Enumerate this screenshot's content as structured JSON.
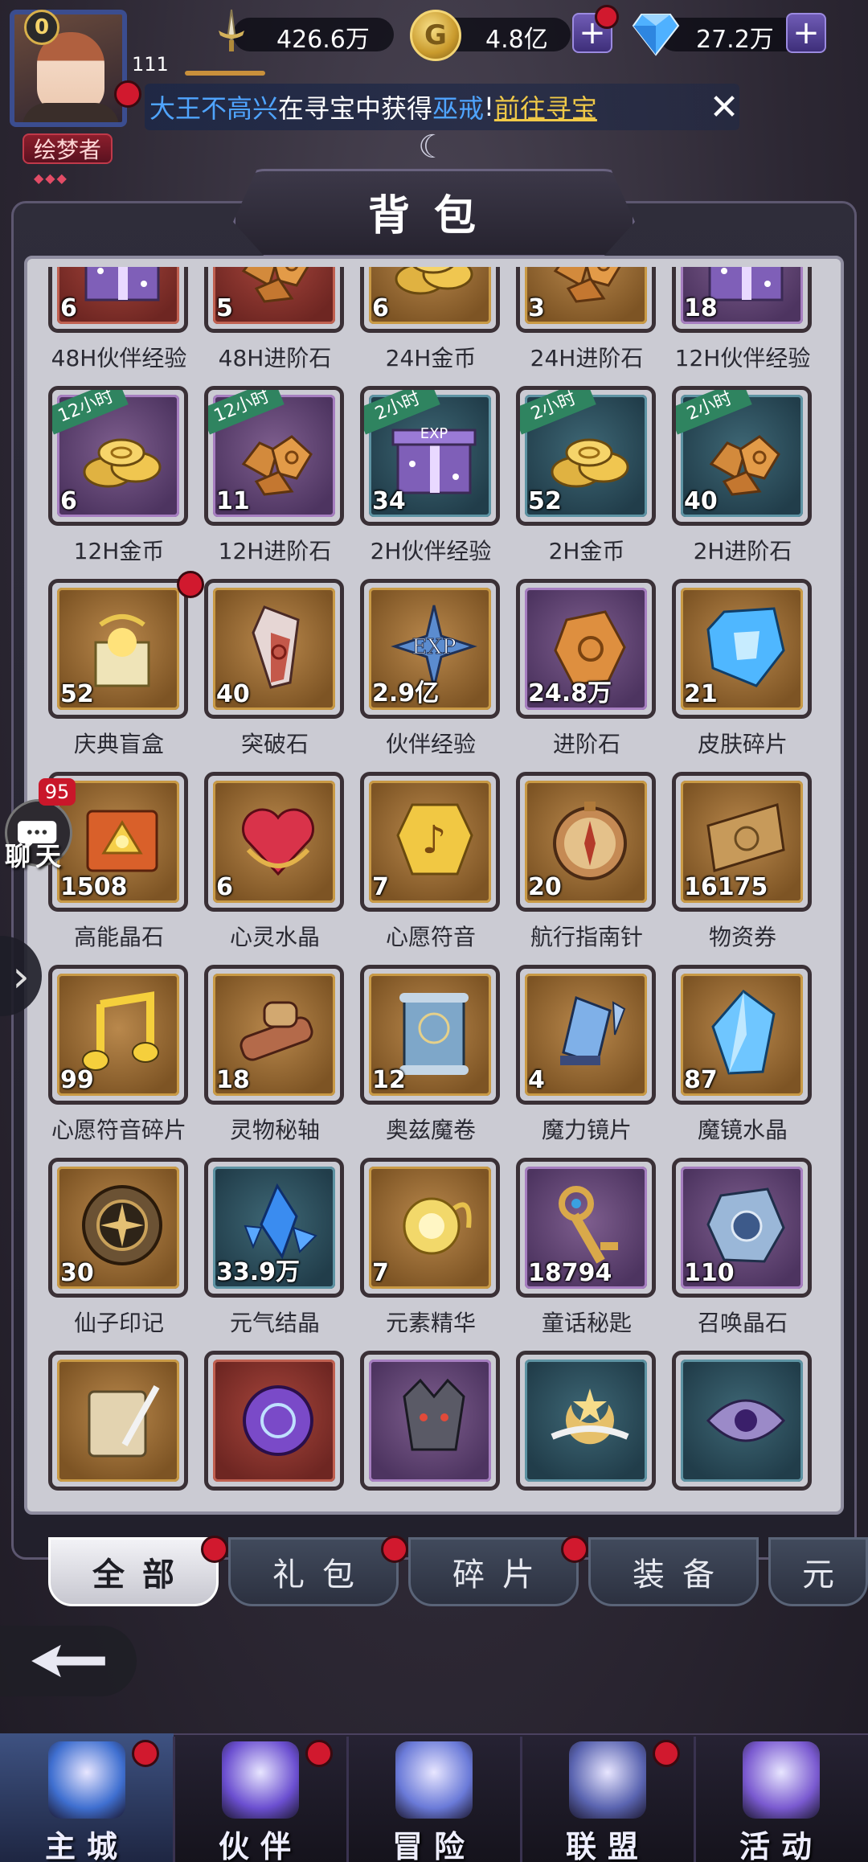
{
  "hud": {
    "level": "0",
    "player_id": "111",
    "title_badge": "绘梦者",
    "title_stars": "◆◆◆",
    "power": "426.6万",
    "coins": "4.8亿",
    "diamonds": "27.2万",
    "coin_glyph": "G"
  },
  "ticker": {
    "player": "大王不高兴",
    "mid": "在寻宝中获得",
    "item": "巫戒",
    "exclaim": "!",
    "link": "前往寻宝"
  },
  "panel": {
    "title": "背包"
  },
  "items": [
    {
      "name": "48H伙伴经验",
      "count": "6",
      "rarity": "red",
      "icon": "exp-gift-box-icon"
    },
    {
      "name": "48H进阶石",
      "count": "5",
      "rarity": "red",
      "icon": "advancement-stone-pile-icon"
    },
    {
      "name": "24H金币",
      "count": "6",
      "rarity": "gold",
      "icon": "gold-coin-pile-icon"
    },
    {
      "name": "24H进阶石",
      "count": "3",
      "rarity": "gold",
      "icon": "advancement-stone-pile-icon"
    },
    {
      "name": "12H伙伴经验",
      "count": "18",
      "rarity": "purple",
      "icon": "exp-gift-box-icon"
    },
    {
      "name": "12H金币",
      "count": "6",
      "rarity": "purple",
      "icon": "gold-coin-pile-icon",
      "ribbon": "12小时"
    },
    {
      "name": "12H进阶石",
      "count": "11",
      "rarity": "purple",
      "icon": "advancement-stone-pile-icon",
      "ribbon": "12小时"
    },
    {
      "name": "2H伙伴经验",
      "count": "34",
      "rarity": "blue",
      "icon": "exp-gift-box-icon",
      "ribbon": "2小时"
    },
    {
      "name": "2H金币",
      "count": "52",
      "rarity": "blue",
      "icon": "gold-coin-pile-icon",
      "ribbon": "2小时"
    },
    {
      "name": "2H进阶石",
      "count": "40",
      "rarity": "blue",
      "icon": "advancement-stone-pile-icon",
      "ribbon": "2小时"
    },
    {
      "name": "庆典盲盒",
      "count": "52",
      "rarity": "gold",
      "icon": "celebration-blind-box-icon",
      "dot": true
    },
    {
      "name": "突破石",
      "count": "40",
      "rarity": "gold",
      "icon": "breakthrough-crystal-icon"
    },
    {
      "name": "伙伴经验",
      "count": "2.9亿",
      "rarity": "gold",
      "icon": "exp-star-icon"
    },
    {
      "name": "进阶石",
      "count": "24.8万",
      "rarity": "purple",
      "icon": "advancement-stone-icon"
    },
    {
      "name": "皮肤碎片",
      "count": "21",
      "rarity": "gold",
      "icon": "skin-shard-crystal-icon"
    },
    {
      "name": "高能晶石",
      "count": "1508",
      "rarity": "gold",
      "icon": "energy-crystal-book-icon"
    },
    {
      "name": "心灵水晶",
      "count": "6",
      "rarity": "gold",
      "icon": "heart-crystal-icon"
    },
    {
      "name": "心愿符音",
      "count": "7",
      "rarity": "gold",
      "icon": "wish-note-coin-icon"
    },
    {
      "name": "航行指南针",
      "count": "20",
      "rarity": "gold",
      "icon": "compass-icon"
    },
    {
      "name": "物资券",
      "count": "16175",
      "rarity": "gold",
      "icon": "supply-ticket-icon"
    },
    {
      "name": "心愿符音碎片",
      "count": "99",
      "rarity": "gold",
      "icon": "music-note-icon"
    },
    {
      "name": "灵物秘轴",
      "count": "18",
      "rarity": "gold",
      "icon": "scroll-bundle-icon"
    },
    {
      "name": "奥兹魔卷",
      "count": "12",
      "rarity": "gold",
      "icon": "magic-scroll-icon"
    },
    {
      "name": "魔力镜片",
      "count": "4",
      "rarity": "gold",
      "icon": "mirror-shard-icon"
    },
    {
      "name": "魔镜水晶",
      "count": "87",
      "rarity": "gold",
      "icon": "blue-crystal-icon"
    },
    {
      "name": "仙子印记",
      "count": "30",
      "rarity": "gold",
      "icon": "fairy-seal-icon"
    },
    {
      "name": "元气结晶",
      "count": "33.9万",
      "rarity": "blue",
      "icon": "vitality-crystal-icon"
    },
    {
      "name": "元素精华",
      "count": "7",
      "rarity": "gold",
      "icon": "element-essence-icon"
    },
    {
      "name": "童话秘匙",
      "count": "18794",
      "rarity": "purple",
      "icon": "fairytale-key-icon"
    },
    {
      "name": "召唤晶石",
      "count": "110",
      "rarity": "purple",
      "icon": "summon-stone-icon"
    },
    {
      "name": "",
      "count": "",
      "rarity": "gold",
      "icon": "quill-scroll-icon"
    },
    {
      "name": "",
      "count": "",
      "rarity": "red",
      "icon": "purple-orb-icon"
    },
    {
      "name": "",
      "count": "",
      "rarity": "purple",
      "icon": "wolf-portrait-icon"
    },
    {
      "name": "",
      "count": "",
      "rarity": "blue",
      "icon": "moon-wing-emblem-icon"
    },
    {
      "name": "",
      "count": "",
      "rarity": "blue",
      "icon": "eye-crest-icon"
    }
  ],
  "chat": {
    "label": "聊天",
    "badge": "95"
  },
  "tabs": [
    {
      "label": "全部",
      "active": true,
      "dot": true
    },
    {
      "label": "礼包",
      "dot": true
    },
    {
      "label": "碎片",
      "dot": true
    },
    {
      "label": "装备",
      "dot": false
    },
    {
      "label": "元",
      "dot": false
    }
  ],
  "nav": [
    {
      "label": "主城",
      "icon": "castle-icon",
      "active": true,
      "dot": true
    },
    {
      "label": "伙伴",
      "icon": "wizard-hat-icon",
      "dot": true
    },
    {
      "label": "冒险",
      "icon": "compass-star-icon",
      "dot": false
    },
    {
      "label": "联盟",
      "icon": "shield-crest-icon",
      "dot": true
    },
    {
      "label": "活动",
      "icon": "cards-icon",
      "dot": false
    }
  ],
  "colors": {
    "rarity_gold": "#b9884c",
    "rarity_red": "#a8463c",
    "rarity_purple": "#7e5e8e",
    "rarity_blue": "#3e6775",
    "ribbon_green": "#2f8460",
    "alert_red": "#d1192e",
    "ticker_blue": "#4fa4ff",
    "ticker_gold": "#f0c948"
  }
}
